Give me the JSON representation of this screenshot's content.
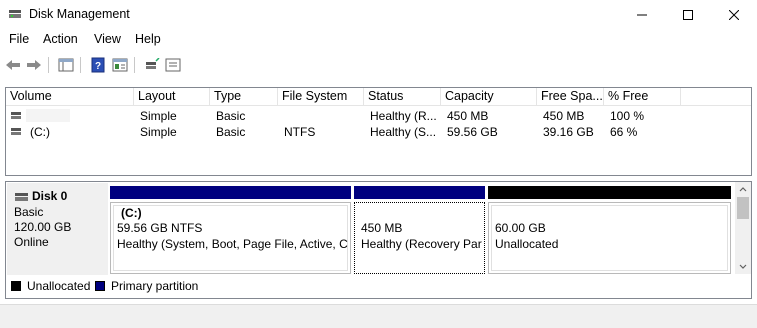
{
  "window": {
    "title": "Disk Management"
  },
  "menu": [
    "File",
    "Action",
    "View",
    "Help"
  ],
  "toolbar": {
    "buttons": [
      "back-icon",
      "forward-icon",
      "list-view-icon",
      "help-icon",
      "properties-icon",
      "connect-icon",
      "console-icon"
    ]
  },
  "volumes": {
    "columns": [
      "Volume",
      "Layout",
      "Type",
      "File System",
      "Status",
      "Capacity",
      "Free Spa...",
      "% Free"
    ],
    "rows": [
      {
        "volume": "",
        "layout": "Simple",
        "type": "Basic",
        "fs": "",
        "status": "Healthy (R...",
        "capacity": "450 MB",
        "free": "450 MB",
        "pct": "100 %"
      },
      {
        "volume": "(C:)",
        "layout": "Simple",
        "type": "Basic",
        "fs": "NTFS",
        "status": "Healthy (S...",
        "capacity": "59.56 GB",
        "free": "39.16 GB",
        "pct": "66 %"
      }
    ]
  },
  "disk": {
    "name": "Disk 0",
    "type": "Basic",
    "size": "120.00 GB",
    "state": "Online",
    "partitions": [
      {
        "title": "(C:)",
        "size": "59.56 GB NTFS",
        "status": "Healthy (System, Boot, Page File, Active, Cr",
        "bar_color": "#00007f"
      },
      {
        "title": "",
        "size": "450 MB",
        "status": "Healthy (Recovery Part",
        "bar_color": "#00007f"
      },
      {
        "title": "",
        "size": "60.00 GB",
        "status": "Unallocated",
        "bar_color": "#000000"
      }
    ]
  },
  "legend": [
    {
      "label": "Unallocated",
      "color": "#000000"
    },
    {
      "label": "Primary partition",
      "color": "#00007f"
    }
  ]
}
